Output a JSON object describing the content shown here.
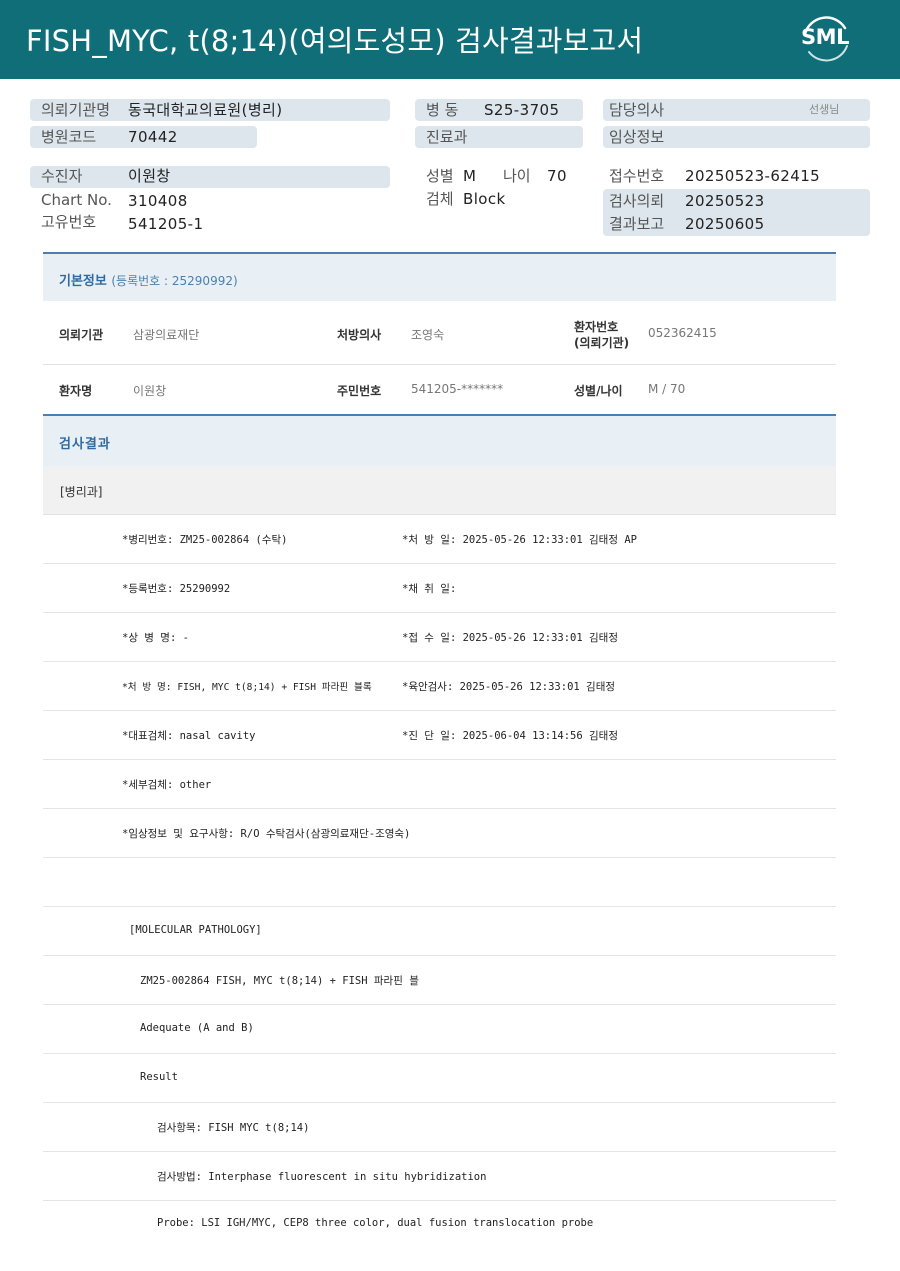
{
  "header": {
    "title": "FISH_MYC, t(8;14)(여의도성모) 검사결과보고서",
    "logo": "SML",
    "bg_color": "#0f6e78"
  },
  "summary": {
    "institution_label": "의뢰기관명",
    "institution": "동국대학교의료원(병리)",
    "hospital_code_label": "병원코드",
    "hospital_code": "70442",
    "ward_label": "병 동",
    "ward": "S25-3705",
    "dept_label": "진료과",
    "dept": "",
    "doctor_label": "담당의사",
    "doctor_suffix": "선생님",
    "clinical_label": "임상정보",
    "clinical": "",
    "patient_label": "수진자",
    "patient": "이원창",
    "chart_label": "Chart No.",
    "chart": "310408",
    "unique_label": "고유번호",
    "unique": "541205-1",
    "sex_label": "성별",
    "sex": "M",
    "age_label": "나이",
    "age": "70",
    "specimen_label": "검체",
    "specimen": "Block",
    "receipt_label": "접수번호",
    "receipt": "20250523-62415",
    "request_label": "검사의뢰",
    "request": "20250523",
    "report_label": "결과보고",
    "report": "20250605"
  },
  "basic_info": {
    "title": "기본정보",
    "reg_label": "(등록번호 : 25290992)",
    "rows": [
      {
        "l1": "의뢰기관",
        "v1": "삼광의료재단",
        "l2": "처방의사",
        "v2": "조영숙",
        "l3a": "환자번호",
        "l3b": "(의뢰기관)",
        "v3": "052362415"
      },
      {
        "l1": "환자명",
        "v1": "이원창",
        "l2": "주민번호",
        "v2": "541205-*******",
        "l3a": "성별/나이",
        "l3b": "",
        "v3": "M / 70"
      }
    ]
  },
  "results": {
    "title": "검사결과",
    "department": "[병리과]",
    "rows": [
      {
        "a": "*병리번호: ZM25-002864 (수탁)",
        "b": "*처 방 일: 2025-05-26 12:33:01  김태정 AP"
      },
      {
        "a": "*등록번호: 25290992",
        "b": "*채 취 일:"
      },
      {
        "a": "*상 병 명: -",
        "b": "*접 수 일: 2025-05-26 12:33:01  김태정"
      },
      {
        "a": "*처 방 명: FISH, MYC t(8;14) + FISH 파라핀 블록",
        "b": "*육안검사: 2025-05-26 12:33:01  김태정"
      },
      {
        "a": "*대표검체: nasal cavity",
        "b": "*진 단 일: 2025-06-04 13:14:56  김태정"
      },
      {
        "a": "*세부검체: other",
        "b": ""
      },
      {
        "a": "*임상정보 및 요구사항: R/O 수탁검사(삼광의료재단-조영숙)",
        "b": ""
      },
      {
        "a": "",
        "b": ""
      }
    ],
    "molecular": [
      {
        "text": "[MOLECULAR PATHOLOGY]",
        "indent": 0
      },
      {
        "text": "ZM25-002864    FISH, MYC t(8;14) + FISH 파라핀 블",
        "indent": 1
      },
      {
        "text": "Adequate (A and B)",
        "indent": 1
      },
      {
        "text": "Result",
        "indent": 1
      },
      {
        "text": "검사항목: FISH MYC t(8;14)",
        "indent": 2
      },
      {
        "text": "검사방법: Interphase fluorescent in situ hybridization",
        "indent": 2
      },
      {
        "text": "Probe: LSI IGH/MYC, CEP8 three color, dual fusion translocation probe",
        "indent": 2
      }
    ]
  }
}
